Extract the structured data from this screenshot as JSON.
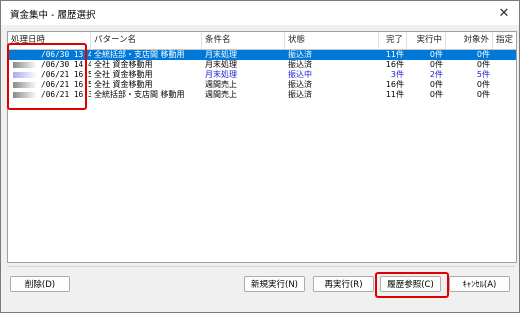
{
  "window": {
    "title": "資金集中 - 履歴選択",
    "close_glyph": "✕"
  },
  "table": {
    "columns": [
      {
        "key": "date",
        "label": "処理日時"
      },
      {
        "key": "pattern",
        "label": "パターン名"
      },
      {
        "key": "condition",
        "label": "条件名"
      },
      {
        "key": "status",
        "label": "状態"
      },
      {
        "key": "done",
        "label": "完了"
      },
      {
        "key": "running",
        "label": "実行中"
      },
      {
        "key": "excluded",
        "label": "対象外"
      },
      {
        "key": "designated",
        "label": "指定"
      }
    ],
    "rows": [
      {
        "date": "/06/30 13:49",
        "pattern": "全統括部・支店間 移動用",
        "condition": "月末処理",
        "status": "振込済",
        "done": "11件",
        "running": "0件",
        "excluded": "0件",
        "color": "#0078d7",
        "selected": true,
        "blue": false
      },
      {
        "date": "/06/30 14:47",
        "pattern": "全社 資金移動用",
        "condition": "月末処理",
        "status": "振込済",
        "done": "16件",
        "running": "0件",
        "excluded": "0件",
        "color": "#8a8a8a",
        "selected": false,
        "blue": false
      },
      {
        "date": "/06/21 16:57",
        "pattern": "全社 資金移動用",
        "condition": "月末処理",
        "status": "振込中",
        "done": "3件",
        "running": "2件",
        "excluded": "5件",
        "color": "#a9a9f5",
        "selected": false,
        "blue": true
      },
      {
        "date": "/06/21 16:55",
        "pattern": "全社 資金移動用",
        "condition": "週間売上",
        "status": "振込済",
        "done": "16件",
        "running": "0件",
        "excluded": "0件",
        "color": "#8a8a8a",
        "selected": false,
        "blue": false
      },
      {
        "date": "/06/21 16:32",
        "pattern": "全統括部・支店間 移動用",
        "condition": "週間売上",
        "status": "振込済",
        "done": "11件",
        "running": "0件",
        "excluded": "0件",
        "color": "#8a8a8a",
        "selected": false,
        "blue": false
      }
    ]
  },
  "buttons": {
    "delete": "削除(D)",
    "new_run": "新規実行(N)",
    "rerun": "再実行(R)",
    "history": "履歴参照(C)",
    "cancel": "ｷｬﾝｾﾙ(A)"
  }
}
